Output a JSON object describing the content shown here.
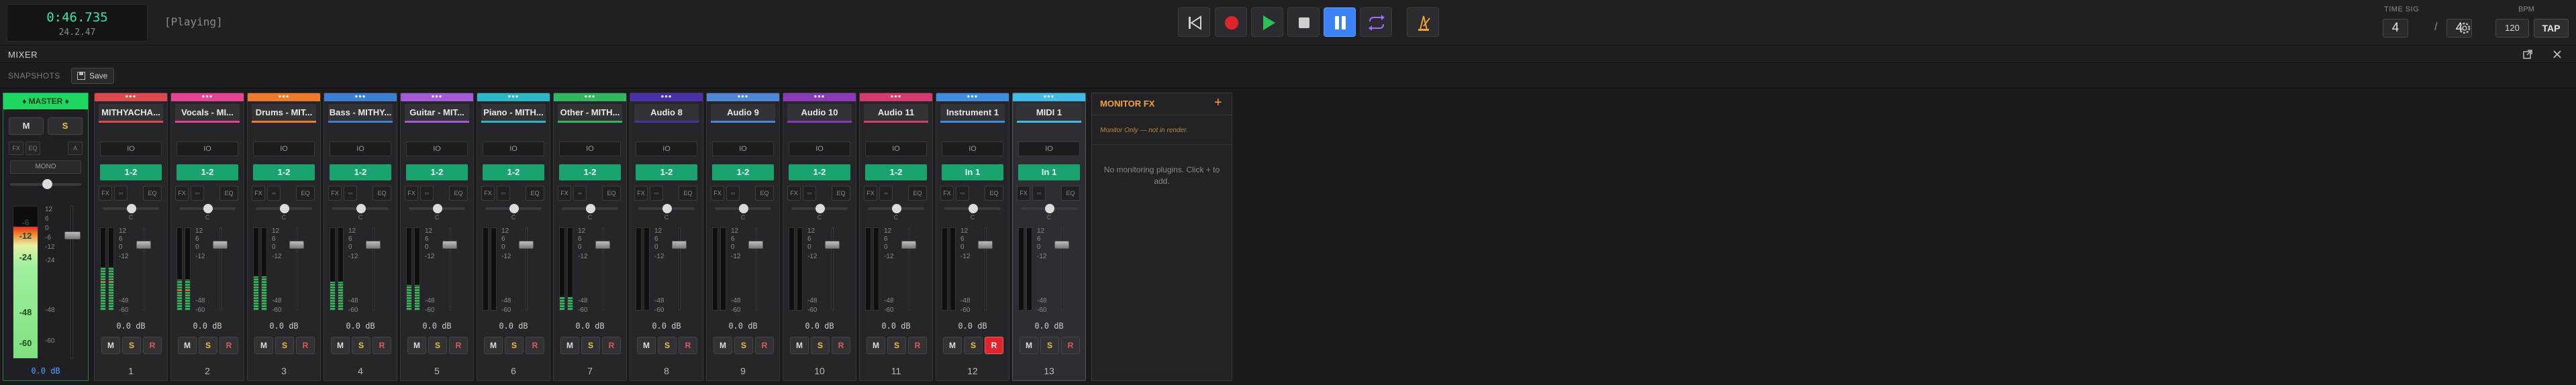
{
  "transport": {
    "time": "0:46.735",
    "bars_beats": "24.2.47",
    "state": "[Playing]",
    "buttons": [
      {
        "name": "skip-back-button",
        "icon": "skip-back-icon"
      },
      {
        "name": "record-button",
        "icon": "record-icon"
      },
      {
        "name": "play-button",
        "icon": "play-icon"
      },
      {
        "name": "stop-button",
        "icon": "stop-icon"
      },
      {
        "name": "pause-button",
        "icon": "pause-icon"
      },
      {
        "name": "loop-button",
        "icon": "loop-icon"
      },
      {
        "name": "metronome-button",
        "icon": "metronome-icon"
      }
    ],
    "time_sig_label": "TIME SIG",
    "time_sig_num": "4",
    "time_sig_slash": "/",
    "time_sig_den": "4",
    "bpm_label": "BPM",
    "bpm": "120",
    "tap": "TAP"
  },
  "mixer": {
    "title": "MIXER",
    "snapshots_label": "SNAPSHOTS",
    "save_label": "Save"
  },
  "master": {
    "label": "♦ MASTER ♦",
    "mute": "M",
    "solo": "S",
    "small_buttons": [
      "FX",
      "EQ",
      "A"
    ],
    "mono": "MONO",
    "meter_marks": [
      "-6",
      "-12",
      "-24",
      "-48",
      "-60"
    ],
    "scale": [
      "12",
      "6",
      "0",
      "-6",
      "-12",
      "-24",
      "-48",
      "-60"
    ],
    "db": "0.0 dB",
    "level": 0.86
  },
  "strip_common": {
    "io": "IO",
    "fx": "FX",
    "eq": "EQ",
    "pan": "C",
    "db": "0.0 dB",
    "mute": "M",
    "solo": "S",
    "rec": "R",
    "scale": [
      "12",
      "6",
      "0",
      "-12",
      "-48",
      "-60"
    ],
    "dots": "•••"
  },
  "strips": [
    {
      "name": "MITHYACHA...",
      "route": "1-2",
      "num": "1",
      "color": "#e0484e",
      "level": 0.52,
      "peak": 0.36
    },
    {
      "name": "Vocals - MI...",
      "route": "1-2",
      "num": "2",
      "color": "#e84393",
      "level": 0.36,
      "peak": 0.26
    },
    {
      "name": "Drums - MIT...",
      "route": "1-2",
      "num": "3",
      "color": "#f07a2a",
      "level": 0.4,
      "peak": 0.0
    },
    {
      "name": "Bass - MITHY...",
      "route": "1-2",
      "num": "4",
      "color": "#3c7fd6",
      "level": 0.34,
      "peak": 0.0
    },
    {
      "name": "Guitar - MIT...",
      "route": "1-2",
      "num": "5",
      "color": "#a45ad8",
      "level": 0.3,
      "peak": 0.0
    },
    {
      "name": "Piano - MITH...",
      "route": "1-2",
      "num": "6",
      "color": "#2ab8c8",
      "level": 0.0,
      "peak": 0.0
    },
    {
      "name": "Other - MITH...",
      "route": "1-2",
      "num": "7",
      "color": "#2fb860",
      "level": 0.16,
      "peak": 0.0
    },
    {
      "name": "Audio 8",
      "route": "1-2",
      "num": "8",
      "color": "#4a2fa8",
      "level": 0.0,
      "peak": 0.0
    },
    {
      "name": "Audio 9",
      "route": "1-2",
      "num": "9",
      "color": "#4f86d8",
      "level": 0.0,
      "peak": 0.0
    },
    {
      "name": "Audio 10",
      "route": "1-2",
      "num": "10",
      "color": "#8a3ab8",
      "level": 0.0,
      "peak": 0.0
    },
    {
      "name": "Audio 11",
      "route": "1-2",
      "num": "11",
      "color": "#d63a6e",
      "level": 0.0,
      "peak": 0.0
    },
    {
      "name": "Instrument 1",
      "route": "In 1",
      "num": "12",
      "color": "#3f8de0",
      "level": 0.0,
      "peak": 0.0,
      "rec_armed": true
    },
    {
      "name": "MIDI 1",
      "route": "In 1",
      "num": "13",
      "color": "#3fbde8",
      "level": 0.0,
      "peak": 0.0,
      "selected": true
    }
  ],
  "monitor": {
    "title": "MONITOR FX",
    "add": "+",
    "note": "Monitor Only — not in render.",
    "empty": "No monitoring plugins. Click + to add."
  },
  "colors": {
    "accent_green": "#1ed760",
    "route_green": "#1aa36f",
    "time_green": "#37e6ad",
    "record_red": "#e0242c",
    "play_green": "#2fbf58",
    "pause_blue": "#3b82f6",
    "solo_yellow": "#f0c23a",
    "monitor_orange": "#f2a33a"
  }
}
